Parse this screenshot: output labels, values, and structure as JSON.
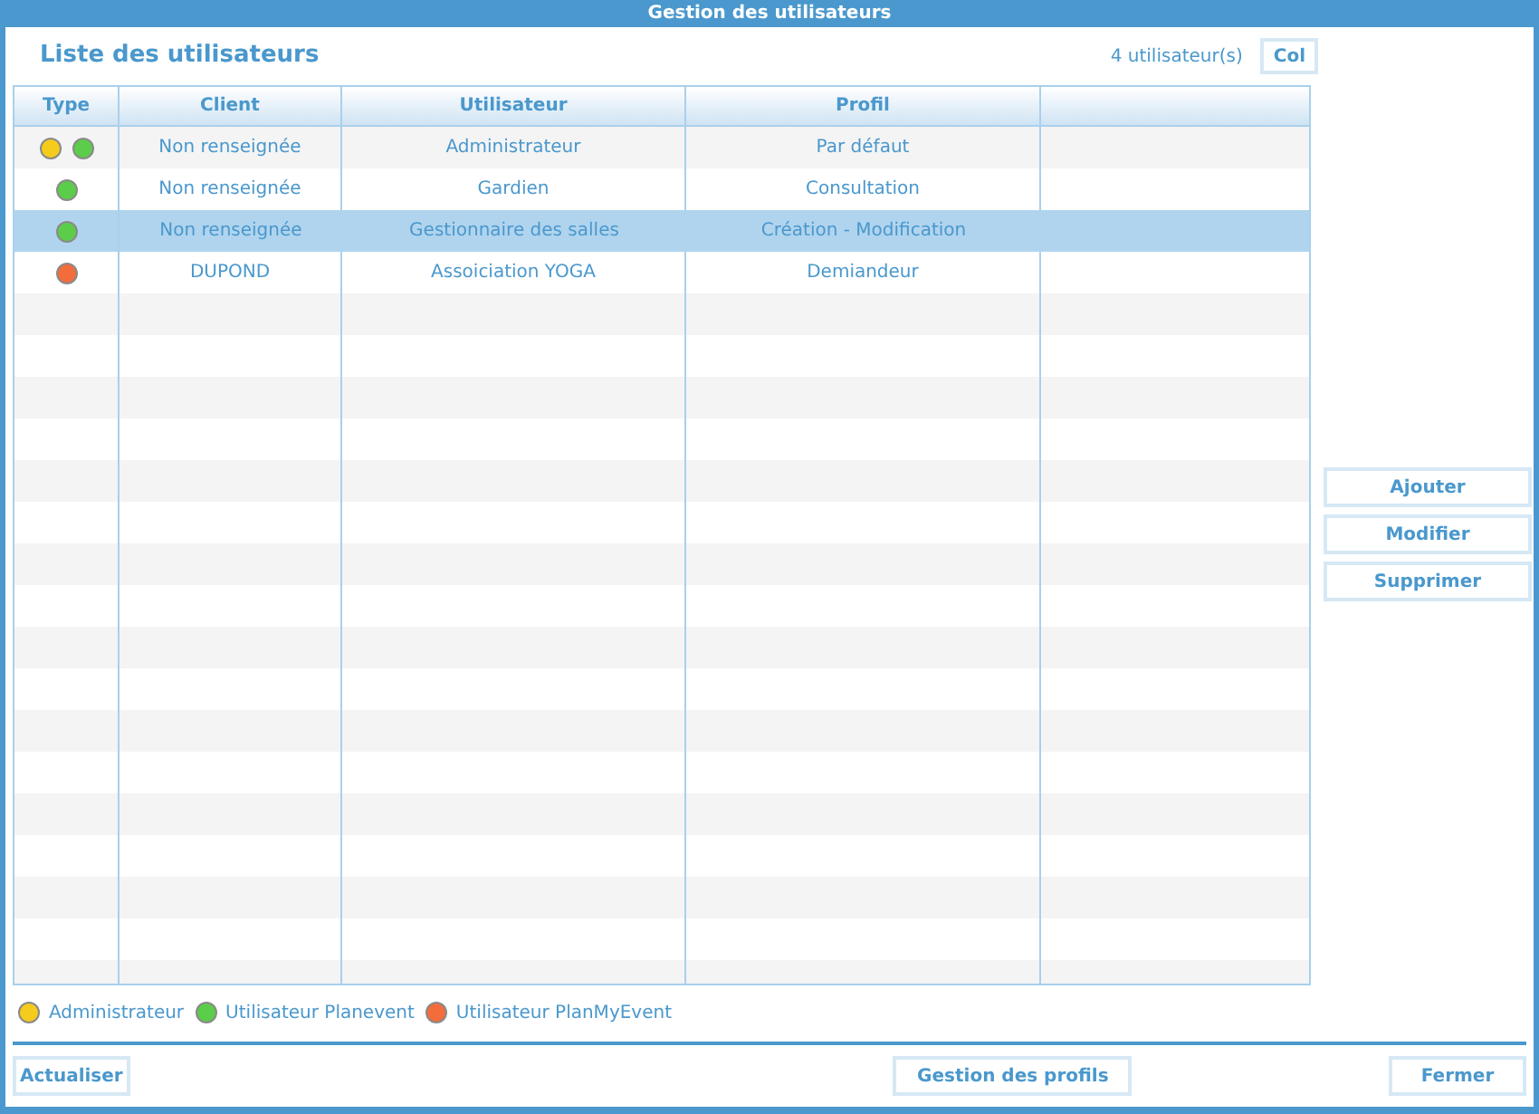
{
  "window": {
    "title": "Gestion des utilisateurs"
  },
  "heading": "Liste des utilisateurs",
  "count": "4 utilisateur(s)",
  "columns_button": "Col",
  "table": {
    "columns": [
      "Type",
      "Client",
      "Utilisateur",
      "Profil"
    ],
    "rows": [
      {
        "types": [
          {
            "color": "#f5cc1c"
          },
          {
            "color": "#5ccd4a"
          }
        ],
        "client": "Non renseignée",
        "user": "Administrateur",
        "profile": "Par défaut",
        "selected": false
      },
      {
        "types": [
          {
            "color": "#5ccd4a"
          }
        ],
        "client": "Non renseignée",
        "user": "Gardien",
        "profile": "Consultation",
        "selected": false
      },
      {
        "types": [
          {
            "color": "#5ccd4a"
          }
        ],
        "client": "Non renseignée",
        "user": "Gestionnaire des salles",
        "profile": "Création - Modification",
        "selected": true
      },
      {
        "types": [
          {
            "color": "#f26c3c"
          }
        ],
        "client": "DUPOND",
        "user": "Assoiciation YOGA",
        "profile": "Demiandeur",
        "selected": false
      }
    ]
  },
  "side_buttons": [
    "Ajouter",
    "Modifier",
    "Supprimer"
  ],
  "legend": [
    {
      "label": "Administrateur",
      "color": "#f5cc1c"
    },
    {
      "label": "Utilisateur Planevent",
      "color": "#5ccd4a"
    },
    {
      "label": "Utilisateur PlanMyEvent",
      "color": "#f26c3c"
    }
  ],
  "footer": {
    "left": "Actualiser",
    "center": "Gestion des profils",
    "right": "Fermer"
  }
}
